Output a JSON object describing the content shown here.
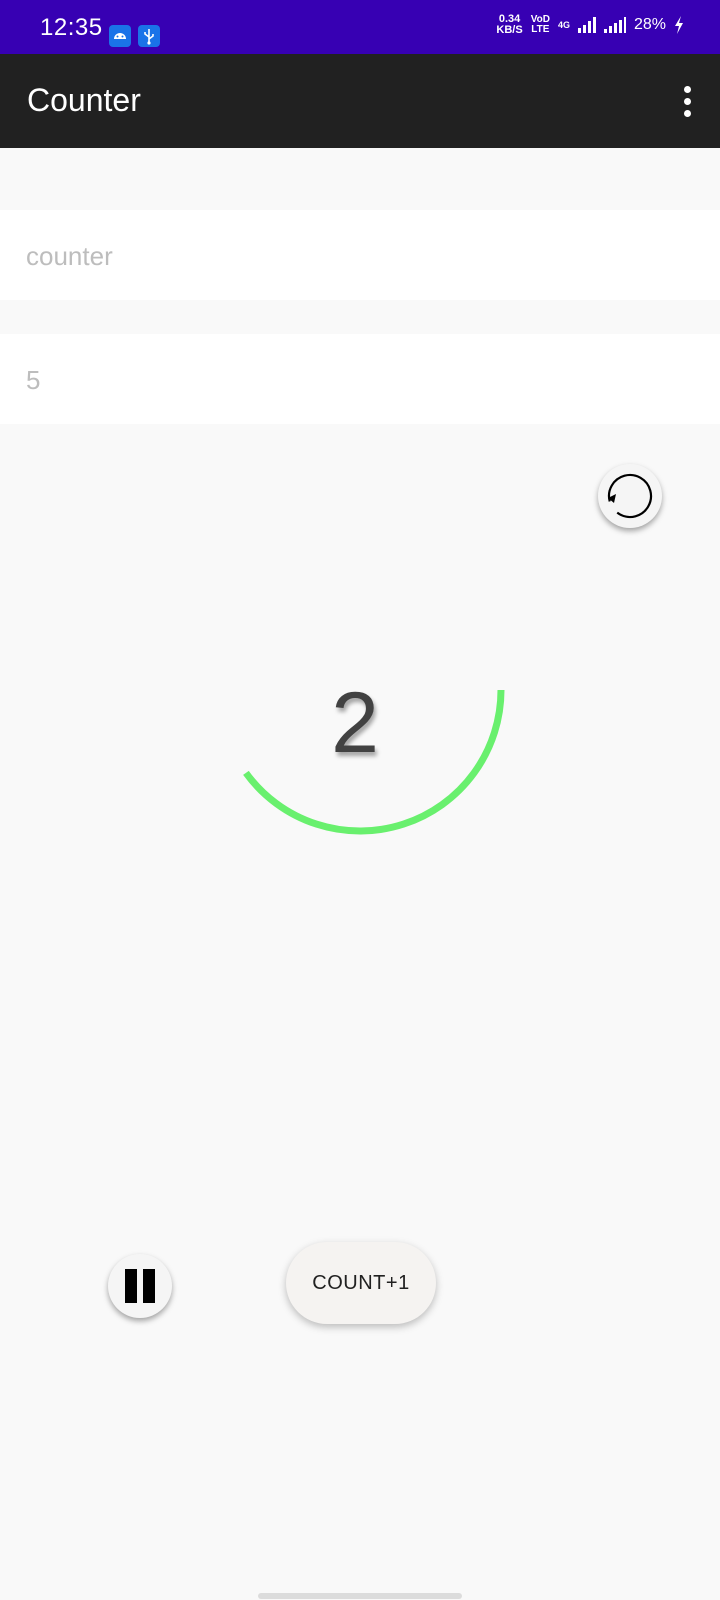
{
  "status_bar": {
    "time": "12:35",
    "net_speed_value": "0.34",
    "net_speed_unit": "KB/S",
    "volte_top": "VoD",
    "volte_bottom": "LTE",
    "network": "4G",
    "battery": "28%",
    "colors": {
      "background": "#3700b3"
    }
  },
  "app_bar": {
    "title": "Counter",
    "menu_icon": "more-vert-icon",
    "colors": {
      "background": "#212121"
    }
  },
  "form": {
    "name_placeholder": "counter",
    "name_value": "",
    "count_placeholder": "5",
    "count_value": ""
  },
  "counter": {
    "value": "2",
    "progress": 0.4,
    "progress_color": "#69f06e",
    "reset_icon": "reset-icon"
  },
  "controls": {
    "pause_icon": "pause-icon",
    "count_button_label": "COUNT+1"
  }
}
